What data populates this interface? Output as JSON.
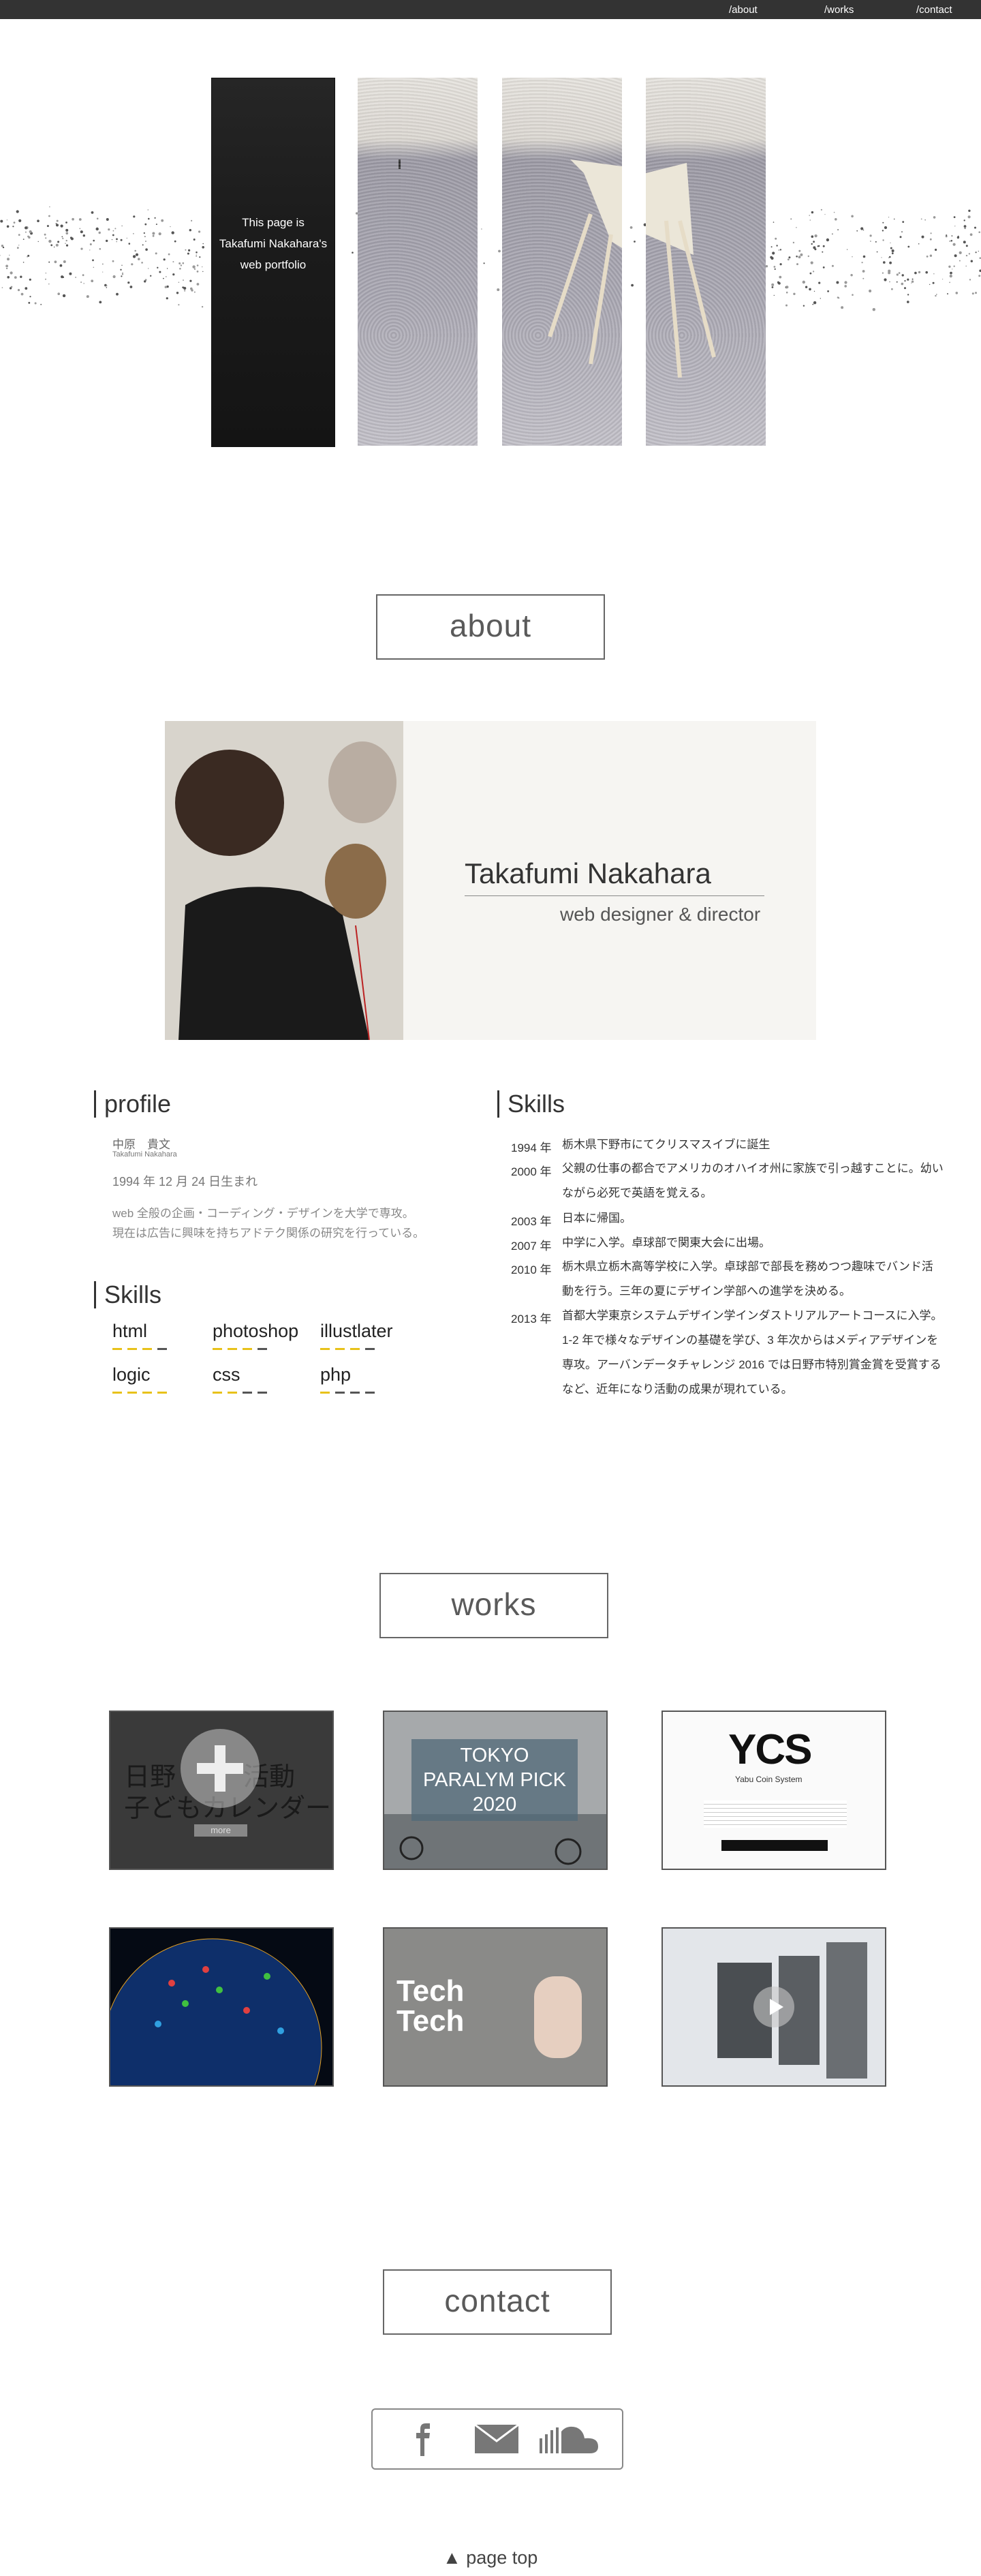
{
  "nav": {
    "about": "/about",
    "works": "/works",
    "contact": "/contact"
  },
  "hero": {
    "line1": "This page is",
    "line2": "Takafumi Nakahara's",
    "line3": "web portfolio"
  },
  "about": {
    "heading": "about",
    "name": "Takafumi Nakahara",
    "role": "web designer & director",
    "profile_heading": "profile",
    "name_jp": "中原　貴文",
    "name_en": "Takafumi Nakahara",
    "birth": "1994 年 12 月 24 日生まれ",
    "desc1": "web 全般の企画・コーディング・デザインを大学で専攻。",
    "desc2": "現在は広告に興味を持ちアドテク関係の研究を行っている。",
    "skills_heading": "Skills",
    "skills": [
      {
        "name": "html",
        "level": 3
      },
      {
        "name": "photoshop",
        "level": 3
      },
      {
        "name": "illustlater",
        "level": 3
      },
      {
        "name": "logic",
        "level": 4
      },
      {
        "name": "css",
        "level": 2
      },
      {
        "name": "php",
        "level": 1
      }
    ],
    "history_heading": "Skills",
    "history": [
      {
        "year": "1994 年",
        "text": "栃木県下野市にてクリスマスイブに誕生"
      },
      {
        "year": "2000 年",
        "text": "父親の仕事の都合でアメリカのオハイオ州に家族で引っ越すことに。幼いながら必死で英語を覚える。"
      },
      {
        "year": "2003 年",
        "text": "日本に帰国。"
      },
      {
        "year": "2007 年",
        "text": "中学に入学。卓球部で関東大会に出場。"
      },
      {
        "year": "2010 年",
        "text": "栃木県立栃木高等学校に入学。卓球部で部長を務めつつ趣味でバンド活動を行う。三年の夏にデザイン学部への進学を決める。"
      },
      {
        "year": "2013 年",
        "text": "首都大学東京システムデザイン学インダストリアルアートコースに入学。1-2 年で様々なデザインの基礎を学び、3 年次からはメディアデザインを専攻。アーバンデータチャレンジ 2016 では日野市特別賞金賞を受賞するなど、近年になり活動の成果が現れている。"
      }
    ]
  },
  "works": {
    "heading": "works",
    "items": [
      {
        "title_a": "日野",
        "title_b": "活動",
        "title_c": "子どもカレンダー",
        "more": "more"
      },
      {
        "title": "TOKYO PARALYM PICK 2020",
        "line1": "TOKYO",
        "line2": "PARALYM PICK",
        "line3": "2020"
      },
      {
        "logo": "YCS",
        "sub": "Yabu Coin System"
      },
      {
        "caption": ""
      },
      {
        "line1": "Tech",
        "line2": "Tech"
      },
      {
        "caption": ""
      }
    ]
  },
  "contact": {
    "heading": "contact"
  },
  "pagetop": "▲ page top",
  "colors": {
    "accent": "#e8c21a",
    "bar": "#333333",
    "card": "#f6f5f2"
  },
  "icons": [
    "facebook-icon",
    "mail-icon",
    "soundcloud-icon"
  ]
}
